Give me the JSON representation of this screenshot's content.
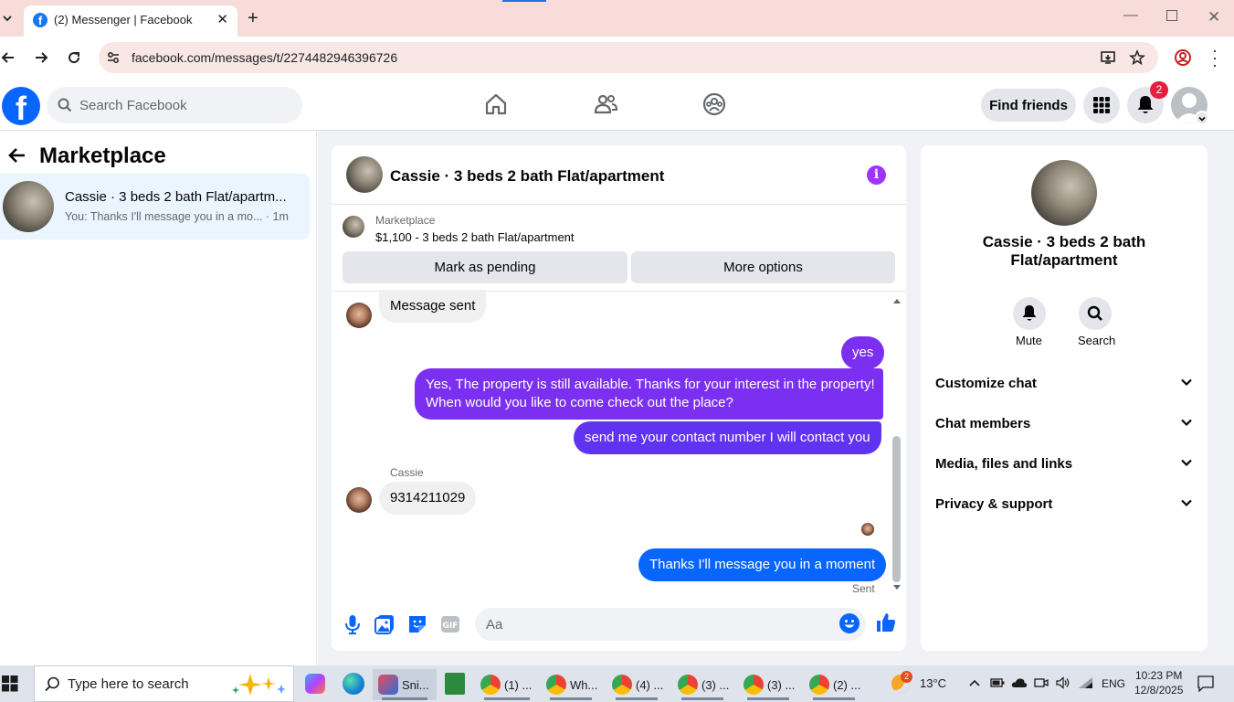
{
  "browser": {
    "tab_title": "(2) Messenger | Facebook",
    "url": "facebook.com/messages/t/2274482946396726"
  },
  "fb_header": {
    "search_placeholder": "Search Facebook",
    "find_friends": "Find friends",
    "notification_count": "2"
  },
  "sidebar": {
    "title": "Marketplace",
    "conversation": {
      "name": "Cassie · 3 beds 2 bath Flat/apartm...",
      "preview": "You: Thanks I'll message you in a mo... · 1m"
    }
  },
  "chat": {
    "title": "Cassie · 3 beds 2 bath Flat/apartment",
    "marketplace_label": "Marketplace",
    "listing": "$1,100 - 3 beds 2 bath Flat/apartment",
    "mark_pending": "Mark as pending",
    "more_options": "More options",
    "messages": {
      "m1": "Message sent",
      "m2": "yes",
      "m3_line1": "Yes, The property is still available. Thanks for your interest in the property!",
      "m3_line2": "When would you like to come check out the place?",
      "m4": "send me your contact number I will contact you",
      "sender": "Cassie",
      "m5": "9314211029",
      "m6": "Thanks I'll message you in a moment",
      "status": "Sent"
    },
    "composer_placeholder": "Aa"
  },
  "info_panel": {
    "name_line1": "Cassie · 3 beds 2 bath",
    "name_line2": "Flat/apartment",
    "mute": "Mute",
    "search": "Search",
    "sections": [
      "Customize chat",
      "Chat members",
      "Media, files and links",
      "Privacy & support"
    ]
  },
  "taskbar": {
    "search_placeholder": "Type here to search",
    "apps": [
      {
        "label": "Sni..."
      },
      {
        "label": "(1) ..."
      },
      {
        "label": "Wh..."
      },
      {
        "label": "(4) ..."
      },
      {
        "label": "(3) ..."
      },
      {
        "label": "(3) ..."
      },
      {
        "label": "(2) ..."
      }
    ],
    "weather_badge": "2",
    "temperature": "13°C",
    "language": "ENG",
    "time": "10:23 PM",
    "date": "12/8/2025"
  }
}
